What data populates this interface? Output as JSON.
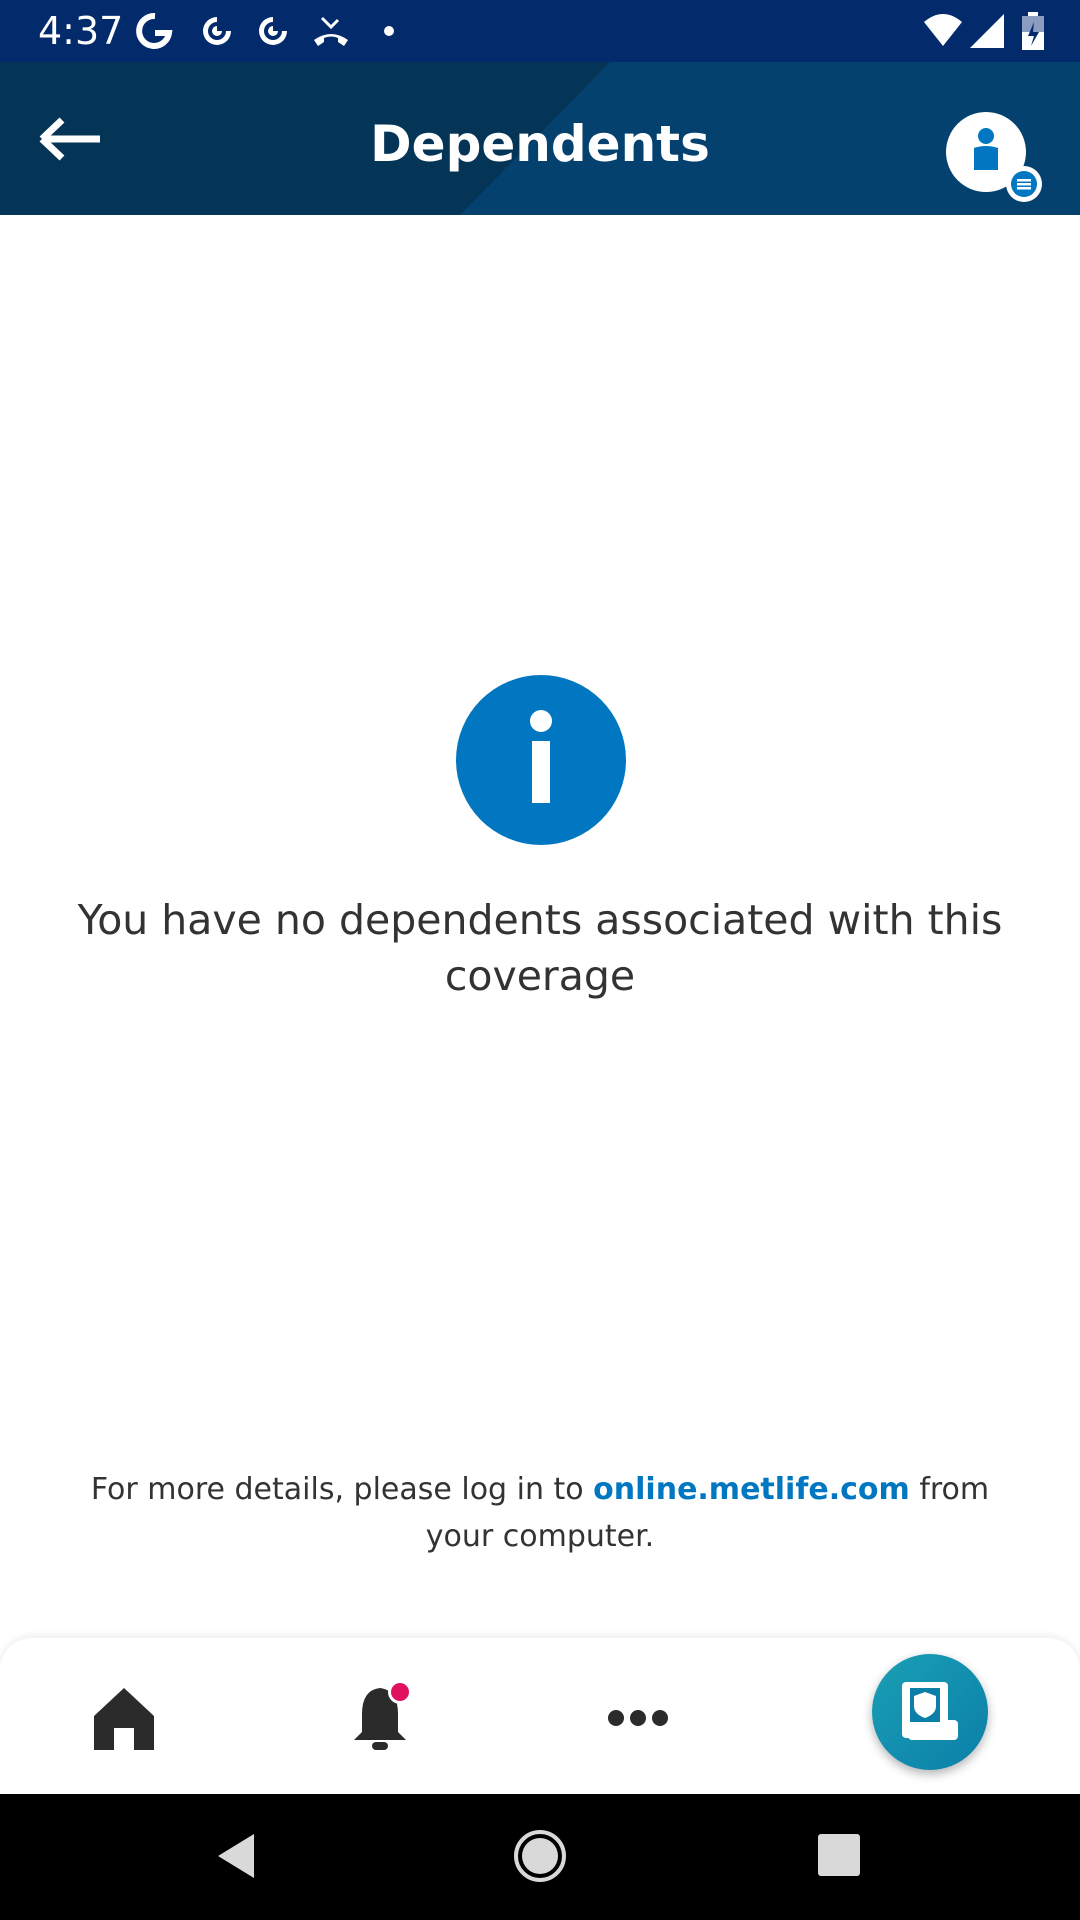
{
  "status_bar": {
    "time": "4:37",
    "left_icons": [
      "google-icon",
      "pocket-casts-icon",
      "pocket-casts-icon",
      "missed-call-icon",
      "dot-icon"
    ],
    "right_icons": [
      "wifi-icon",
      "signal-icon",
      "battery-icon"
    ]
  },
  "header": {
    "title": "Dependents",
    "back_icon": "arrow-left-icon",
    "profile_icon": "profile-menu-icon",
    "background": "#053d66"
  },
  "empty_state": {
    "icon": "info-icon",
    "message": "You have no dependents associated with this coverage",
    "icon_color": "#0077c0"
  },
  "details": {
    "prefix": "For more details, please log in to ",
    "link": "online.metlife.com",
    "suffix": " from your computer."
  },
  "bottom_nav": {
    "items": [
      "home-icon",
      "notifications-icon",
      "more-icon",
      "id-card-icon"
    ],
    "notification_dot_color": "#e0115f",
    "fab_color": "#1a9fb5"
  },
  "system_nav": {
    "buttons": [
      "back-icon",
      "home-icon",
      "recents-icon"
    ]
  }
}
